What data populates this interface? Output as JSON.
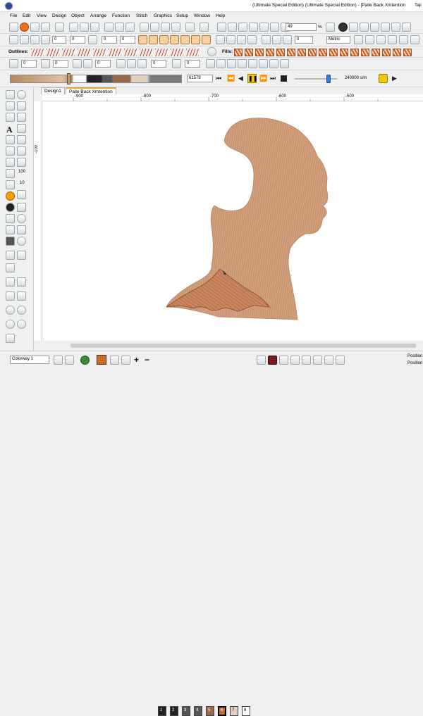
{
  "window": {
    "title": "(Ultimate Special Edition) (Ultimate Special Edition) - [Palle Back Xmtention",
    "title_right": "Taji"
  },
  "menu": [
    "File",
    "Edit",
    "View",
    "Design",
    "Object",
    "Arrange",
    "Function",
    "Stitch",
    "Graphics",
    "Setup",
    "Window",
    "Help"
  ],
  "toolbar1": {
    "zoom_value": "49",
    "zoom_unit": "%",
    "units_value": "Metric",
    "stepper_values": [
      "0",
      "0",
      "0",
      "0",
      "0",
      "0"
    ]
  },
  "toolbar2": {
    "outlines_label": "Outlines:",
    "fills_label": "Fills:"
  },
  "toolbar3": {
    "field_values": [
      "0",
      "0",
      "0",
      "0",
      "0"
    ]
  },
  "playback": {
    "stitch_count": "61579",
    "speed_label": "240000 s/m"
  },
  "tabs": [
    "Design1",
    "Palle Back Xmtention"
  ],
  "ruler_h_labels": [
    "-900",
    "-800",
    "-700",
    "-600",
    "-500"
  ],
  "ruler_v_labels": [
    "-100"
  ],
  "side_labels": [
    "100",
    "10"
  ],
  "status": {
    "colorway": "Colorway 1",
    "position_a": "Position",
    "position_b": "Position",
    "swatch_numbers": [
      "1",
      "2",
      "3",
      "4",
      "5",
      "6",
      "7",
      "8"
    ]
  },
  "colors": {
    "skin": "#d2a07c",
    "accent_orange": "#c76b2e",
    "title_bg": "#ffffff"
  }
}
